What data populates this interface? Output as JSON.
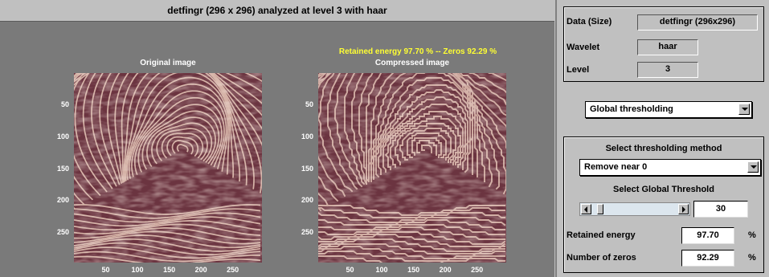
{
  "figure": {
    "title": "detfingr (296 x 296) analyzed at level 3 with haar",
    "left_plot": {
      "title": "Original image"
    },
    "right_plot": {
      "annotation": "Retained energy 97.70 % -- Zeros 92.29 %",
      "title": "Compressed image"
    },
    "y_ticks": [
      "50",
      "100",
      "150",
      "200",
      "250"
    ],
    "x_ticks": [
      "50",
      "100",
      "150",
      "200",
      "250"
    ]
  },
  "panel": {
    "data_label": "Data  (Size)",
    "data_value": "detfingr  (296x296)",
    "wavelet_label": "Wavelet",
    "wavelet_value": "haar",
    "level_label": "Level",
    "level_value": "3",
    "mode_select": "Global thresholding",
    "method_header": "Select thresholding method",
    "method_select": "Remove near 0",
    "threshold_header": "Select Global Threshold",
    "threshold_value": "30",
    "threshold_slider_fraction": 0.05,
    "retained_label": "Retained energy",
    "retained_value": "97.70",
    "zeros_label": "Number of zeros",
    "zeros_value": "92.29",
    "percent_sign": "%"
  },
  "colors": {
    "figure_bg": "#7a7a7a",
    "panel_bg": "#c0c0c0",
    "annotation": "#ffff33",
    "image_dark": "#6b3440",
    "image_light": "#e8c8b8"
  }
}
